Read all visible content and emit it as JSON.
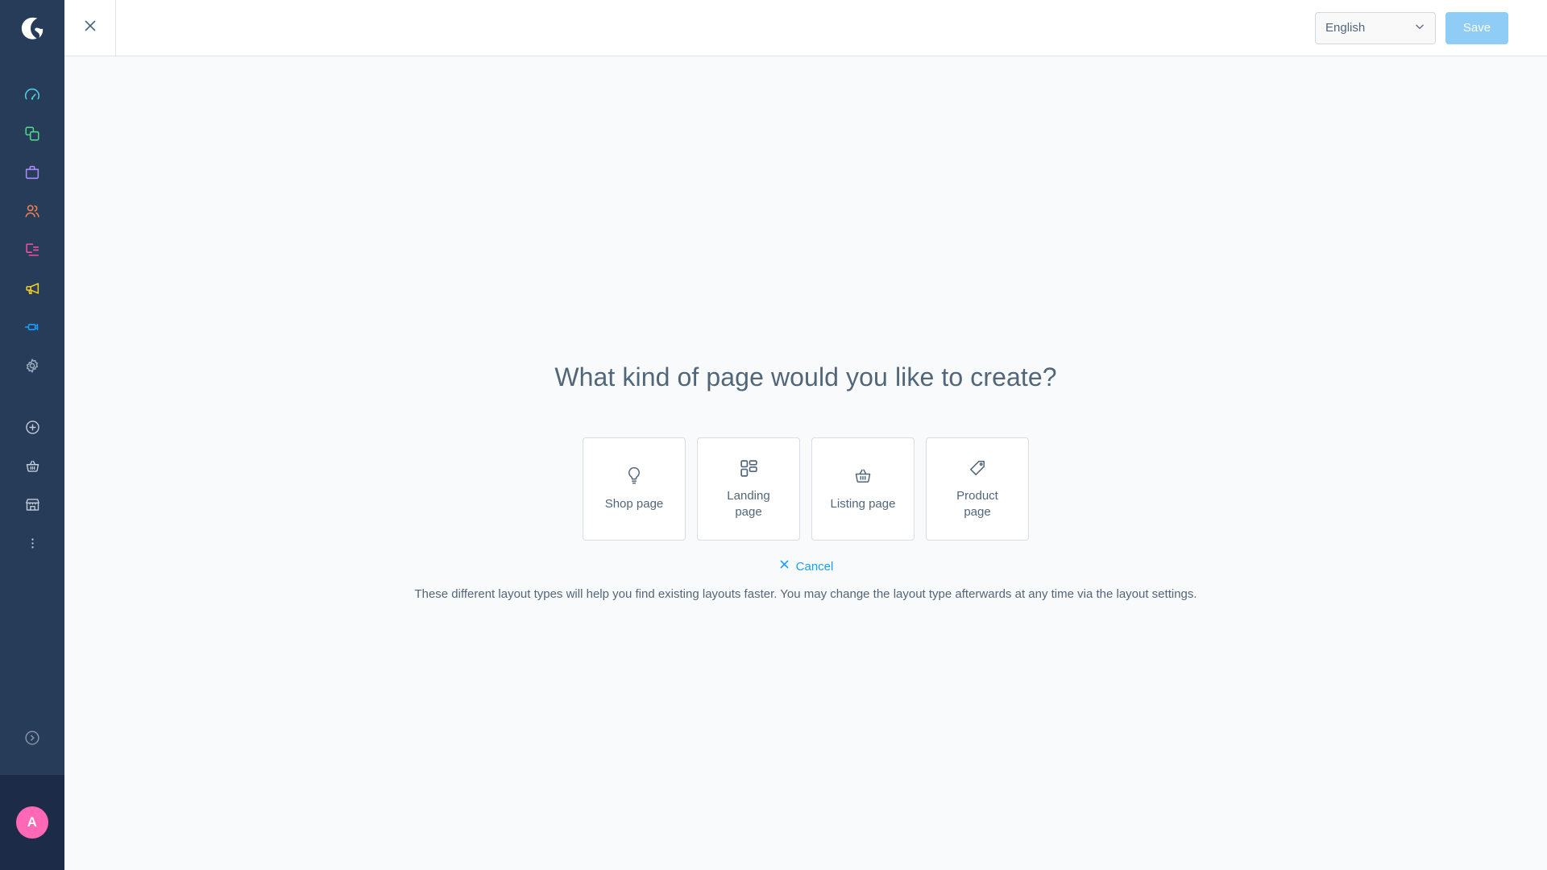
{
  "sidebar": {
    "logo_name": "shopware-logo",
    "items": [
      {
        "name": "dashboard",
        "icon": "gauge-icon",
        "color": "#4dd0e1"
      },
      {
        "name": "catalogues",
        "icon": "copy-squares-icon",
        "color": "#4fd38a"
      },
      {
        "name": "orders",
        "icon": "briefcase-icon",
        "color": "#a78bfa"
      },
      {
        "name": "customers",
        "icon": "users-icon",
        "color": "#f4804f"
      },
      {
        "name": "content",
        "icon": "content-list-icon",
        "color": "#f050a0"
      },
      {
        "name": "marketing",
        "icon": "megaphone-icon",
        "color": "#f5cf26"
      },
      {
        "name": "extensions",
        "icon": "plug-icon",
        "color": "#189eff"
      },
      {
        "name": "settings",
        "icon": "gear-icon",
        "color": "#9aa8ba"
      }
    ],
    "secondary_items": [
      {
        "name": "add",
        "icon": "plus-circle-icon",
        "color": "#c3ccd9"
      },
      {
        "name": "storefront-basket",
        "icon": "basket-icon",
        "color": "#c3ccd9"
      },
      {
        "name": "store",
        "icon": "shop-icon",
        "color": "#c3ccd9"
      },
      {
        "name": "more",
        "icon": "more-vertical-icon",
        "color": "#c3ccd9"
      }
    ],
    "expand": {
      "name": "expand-sidebar",
      "icon": "chevron-right-circle-icon",
      "color": "#9aa8ba"
    },
    "avatar": {
      "initial": "A",
      "color": "#ff68b4"
    }
  },
  "topbar": {
    "close_icon": "close-icon",
    "title": "",
    "language": {
      "selected": "English",
      "chevron": "chevron-down-icon",
      "options": [
        "English"
      ]
    },
    "save_label": "Save",
    "save_color": "#8fcdf7"
  },
  "main": {
    "headline": "What kind of page would you like to create?",
    "cards": [
      {
        "label": "Shop page",
        "icon": "lightbulb-icon"
      },
      {
        "label": "Landing page",
        "icon": "blocks-grid-icon"
      },
      {
        "label": "Listing page",
        "icon": "basket-icon"
      },
      {
        "label": "Product page",
        "icon": "tag-icon"
      }
    ],
    "cancel": {
      "label": "Cancel",
      "icon": "close-x-icon",
      "color": "#189eff"
    },
    "description": "These different layout types will help you find existing layouts faster. You may change the layout type afterwards at any time via the layout settings."
  }
}
